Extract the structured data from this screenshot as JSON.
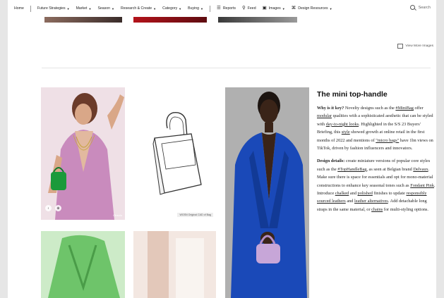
{
  "nav": {
    "home": "Home",
    "items": [
      "Future Strategies",
      "Market",
      "Season",
      "Research & Create",
      "Category",
      "Buying"
    ],
    "utility": [
      "Reports",
      "Feed",
      "Images",
      "Design Resources"
    ],
    "search_placeholder": "Search"
  },
  "view_more": "View More Images",
  "images": {
    "tile1_credit": "Obsolu",
    "tile2_credit": "WGSN Original CAD of Bag"
  },
  "article": {
    "title": "The mini top-handle",
    "p1": [
      {
        "t": "Why is it key?",
        "b": true
      },
      {
        "t": " Novelty designs such as the "
      },
      {
        "t": "#MiniBag",
        "l": true
      },
      {
        "t": " offer "
      },
      {
        "t": "modular",
        "l": true
      },
      {
        "t": " qualities with a sophisticated aesthetic that can be styled with "
      },
      {
        "t": "day-to-night looks",
        "l": true
      },
      {
        "t": ". Highlighted in the S/S 23 Buyers' Briefing, this "
      },
      {
        "t": "style",
        "l": true
      },
      {
        "t": " showed growth at online retail in the first months of 2022 and mentions of "
      },
      {
        "t": "\"micro bags\"",
        "l": true
      },
      {
        "t": " have 1bn views on TikTok, driven by fashion influencers and innovators."
      }
    ],
    "p2": [
      {
        "t": "Design details:",
        "b": true
      },
      {
        "t": " create miniature versions of popular core styles such as the "
      },
      {
        "t": "#TopHandleBag",
        "l": true
      },
      {
        "t": ", as seen at Belgian brand "
      },
      {
        "t": "Delvaux",
        "l": true
      },
      {
        "t": ". Make sure there is space for essentials and opt for mono-material constructions to enhance key seasonal tones such as "
      },
      {
        "t": "Fondant Pink",
        "l": true
      },
      {
        "t": ". Introduce "
      },
      {
        "t": "chalked",
        "l": true
      },
      {
        "t": " and "
      },
      {
        "t": "polished",
        "l": true
      },
      {
        "t": " finishes to update "
      },
      {
        "t": "responsibly sourced leathers",
        "l": true
      },
      {
        "t": " and "
      },
      {
        "t": "leather alternatives",
        "l": true
      },
      {
        "t": ". Add detachable long straps in the same material, or "
      },
      {
        "t": "chains",
        "l": true
      },
      {
        "t": " for multi-styling options."
      }
    ]
  },
  "colors": {
    "accent_pink": "#f3c6d8",
    "jacket_blue": "#1a49b8",
    "bag_green": "#1b9a3a",
    "bag_lilac": "#c7a6d8"
  }
}
